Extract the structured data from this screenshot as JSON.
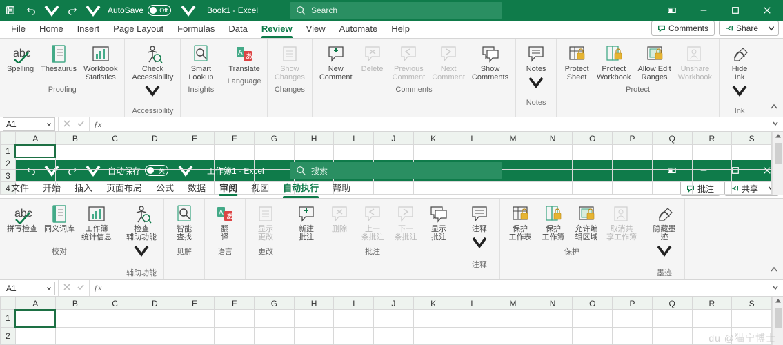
{
  "top": {
    "autosave_label": "AutoSave",
    "autosave_state": "Off",
    "doc_title": "Book1  -  Excel",
    "search_placeholder": "Search",
    "tabs": [
      "File",
      "Home",
      "Insert",
      "Page Layout",
      "Formulas",
      "Data",
      "Review",
      "View",
      "Automate",
      "Help"
    ],
    "tabs_active": 6,
    "comments_btn": "Comments",
    "share_btn": "Share",
    "ribbon": {
      "groups": [
        {
          "label": "Proofing",
          "cmds": [
            {
              "label": "Spelling",
              "icon": "spelling",
              "interact": true
            },
            {
              "label": "Thesaurus",
              "icon": "thesaurus",
              "interact": true
            },
            {
              "label": "Workbook\nStatistics",
              "icon": "wbstats",
              "interact": true
            }
          ]
        },
        {
          "label": "Accessibility",
          "cmds": [
            {
              "label": "Check\nAccessibility",
              "icon": "accessibility",
              "dd": true,
              "interact": true
            }
          ]
        },
        {
          "label": "Insights",
          "cmds": [
            {
              "label": "Smart\nLookup",
              "icon": "smartlookup",
              "interact": true
            }
          ]
        },
        {
          "label": "Language",
          "cmds": [
            {
              "label": "Translate",
              "icon": "translate",
              "interact": true
            }
          ]
        },
        {
          "label": "Changes",
          "cmds": [
            {
              "label": "Show\nChanges",
              "icon": "showchanges",
              "disabled": true
            }
          ]
        },
        {
          "label": "Comments",
          "cmds": [
            {
              "label": "New\nComment",
              "icon": "newcomment",
              "interact": true
            },
            {
              "label": "Delete",
              "icon": "delete",
              "disabled": true
            },
            {
              "label": "Previous\nComment",
              "icon": "prevcomment",
              "disabled": true
            },
            {
              "label": "Next\nComment",
              "icon": "nextcomment",
              "disabled": true
            },
            {
              "label": "Show\nComments",
              "icon": "showcomments",
              "interact": true
            }
          ]
        },
        {
          "label": "Notes",
          "cmds": [
            {
              "label": "Notes",
              "icon": "notes",
              "dd": true,
              "interact": true
            }
          ]
        },
        {
          "label": "Protect",
          "cmds": [
            {
              "label": "Protect\nSheet",
              "icon": "protectsheet",
              "interact": true
            },
            {
              "label": "Protect\nWorkbook",
              "icon": "protectwb",
              "interact": true
            },
            {
              "label": "Allow Edit\nRanges",
              "icon": "alloweditranges",
              "interact": true
            },
            {
              "label": "Unshare\nWorkbook",
              "icon": "unshare",
              "disabled": true
            }
          ]
        },
        {
          "label": "Ink",
          "cmds": [
            {
              "label": "Hide\nInk",
              "icon": "hideink",
              "dd": true,
              "interact": true
            }
          ]
        }
      ]
    },
    "namebox": "A1",
    "columns": [
      "A",
      "B",
      "C",
      "D",
      "E",
      "F",
      "G",
      "H",
      "I",
      "J",
      "K",
      "L",
      "M",
      "N",
      "O",
      "P",
      "Q",
      "R",
      "S"
    ],
    "rows": [
      "1",
      "2",
      "3",
      "4"
    ]
  },
  "bot": {
    "autosave_label": "自动保存",
    "autosave_state": "关",
    "doc_title": "工作簿1  -  Excel",
    "search_placeholder": "搜索",
    "tabs": [
      "文件",
      "开始",
      "插入",
      "页面布局",
      "公式",
      "数据",
      "审阅",
      "视图",
      "自动执行",
      "帮助"
    ],
    "tabs_active": 8,
    "tabs_bold": 6,
    "comments_btn": "批注",
    "share_btn": "共享",
    "ribbon": {
      "groups": [
        {
          "label": "校对",
          "cmds": [
            {
              "label": "拼写检查",
              "icon": "spelling",
              "interact": true
            },
            {
              "label": "同义词库",
              "icon": "thesaurus",
              "interact": true
            },
            {
              "label": "工作簿\n统计信息",
              "icon": "wbstats",
              "interact": true
            }
          ]
        },
        {
          "label": "辅助功能",
          "cmds": [
            {
              "label": "检查\n辅助功能",
              "icon": "accessibility",
              "dd": true,
              "interact": true
            }
          ]
        },
        {
          "label": "见解",
          "cmds": [
            {
              "label": "智能\n查找",
              "icon": "smartlookup",
              "interact": true
            }
          ]
        },
        {
          "label": "语言",
          "cmds": [
            {
              "label": "翻\n译",
              "icon": "translate",
              "interact": true
            }
          ]
        },
        {
          "label": "更改",
          "cmds": [
            {
              "label": "显示\n更改",
              "icon": "showchanges",
              "disabled": true
            }
          ]
        },
        {
          "label": "批注",
          "cmds": [
            {
              "label": "新建\n批注",
              "icon": "newcomment",
              "interact": true
            },
            {
              "label": "删除",
              "icon": "delete",
              "disabled": true
            },
            {
              "label": "上一\n条批注",
              "icon": "prevcomment",
              "disabled": true
            },
            {
              "label": "下一\n条批注",
              "icon": "nextcomment",
              "disabled": true
            },
            {
              "label": "显示\n批注",
              "icon": "showcomments",
              "interact": true
            }
          ]
        },
        {
          "label": "注释",
          "cmds": [
            {
              "label": "注释",
              "icon": "notes",
              "dd": true,
              "interact": true
            }
          ]
        },
        {
          "label": "保护",
          "cmds": [
            {
              "label": "保护\n工作表",
              "icon": "protectsheet",
              "interact": true
            },
            {
              "label": "保护\n工作簿",
              "icon": "protectwb",
              "interact": true
            },
            {
              "label": "允许编\n辑区域",
              "icon": "alloweditranges",
              "interact": true
            },
            {
              "label": "取消共\n享工作簿",
              "icon": "unshare",
              "disabled": true
            }
          ]
        },
        {
          "label": "墨迹",
          "cmds": [
            {
              "label": "隐藏墨\n迹",
              "icon": "hideink",
              "dd": true,
              "interact": true
            }
          ]
        }
      ]
    },
    "namebox": "A1",
    "columns": [
      "A",
      "B",
      "C",
      "D",
      "E",
      "F",
      "G",
      "H",
      "I",
      "J",
      "K",
      "L",
      "M",
      "N",
      "O",
      "P",
      "Q",
      "R",
      "S"
    ],
    "rows": [
      "1",
      "2"
    ]
  },
  "watermark": "du @猫宁博士"
}
